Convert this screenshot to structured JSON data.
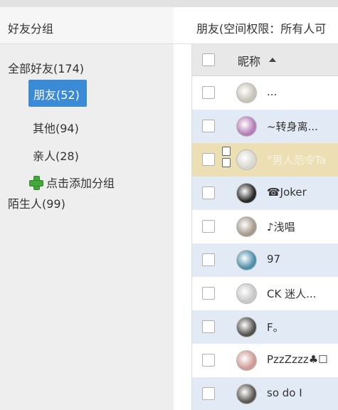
{
  "left_panel": {
    "title": "好友分组",
    "groups": [
      {
        "label": "全部好友(174)"
      },
      {
        "label": "朋友(52)",
        "selected": true
      },
      {
        "label": "其他(94)"
      },
      {
        "label": "亲人(28)"
      }
    ],
    "add_group_label": "点击添加分组",
    "stranger_label": "陌生人(99)"
  },
  "right_panel": {
    "title": "朋友(空间权限：所有人可",
    "column_nickname": "昵称",
    "contacts": [
      {
        "nickname": "...",
        "avatar_color": "#c9c4b8"
      },
      {
        "nickname": "~转身离...",
        "avatar_color": "#b57db8"
      },
      {
        "nickname": "°男人范令Ta",
        "avatar_color": "#d8d6cf"
      },
      {
        "nickname": "☎Joker",
        "avatar_color": "#2a2a2a"
      },
      {
        "nickname": "♪浅唱",
        "avatar_color": "#a69a8a"
      },
      {
        "nickname": "97",
        "avatar_color": "#4f8fa9"
      },
      {
        "nickname": "CK 迷人...",
        "avatar_color": "#c8c8c8"
      },
      {
        "nickname": "F。",
        "avatar_color": "#555350"
      },
      {
        "nickname": "PzzZzzz♣☐",
        "avatar_color": "#d09a94"
      },
      {
        "nickname": "so  do  I",
        "avatar_color": "#5b5752"
      }
    ]
  },
  "colors": {
    "selected_group": "#3a8ad6",
    "row_alt": "#e1eaf5",
    "row_highlight": "#ecdfb4",
    "add_icon": "#43a83a"
  },
  "icons": [
    "plus-icon",
    "sort-ascending-icon",
    "avatar-icon"
  ]
}
